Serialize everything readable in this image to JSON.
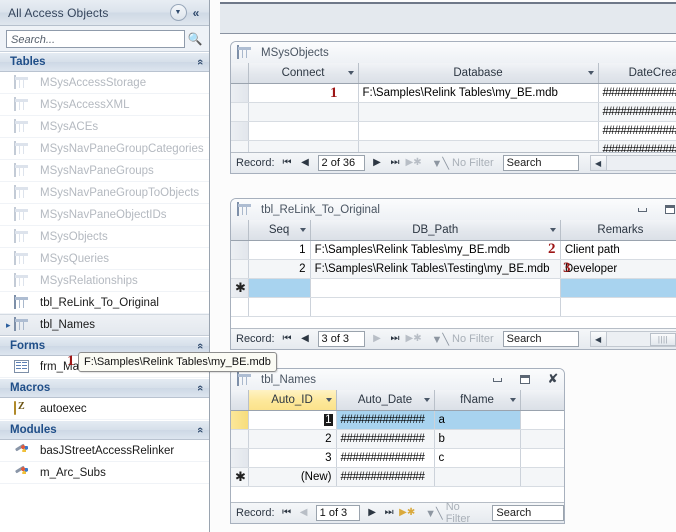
{
  "nav_pane": {
    "title": "All Access Objects",
    "dropdown_icon": "chevron-down-icon",
    "collapse_icon": "double-chevron-left-icon",
    "search": {
      "placeholder": "Search...",
      "value": "",
      "icon": "search-icon"
    },
    "groups": [
      {
        "label": "Tables",
        "collapse_glyph": "«",
        "items": [
          {
            "label": "MSysAccessStorage",
            "icon": "table-icon",
            "dim": true,
            "selected": false,
            "arrow": false
          },
          {
            "label": "MSysAccessXML",
            "icon": "table-icon",
            "dim": true,
            "selected": false,
            "arrow": false
          },
          {
            "label": "MSysACEs",
            "icon": "table-icon",
            "dim": true,
            "selected": false,
            "arrow": false
          },
          {
            "label": "MSysNavPaneGroupCategories",
            "icon": "table-icon",
            "dim": true,
            "selected": false,
            "arrow": false
          },
          {
            "label": "MSysNavPaneGroups",
            "icon": "table-icon",
            "dim": true,
            "selected": false,
            "arrow": false
          },
          {
            "label": "MSysNavPaneGroupToObjects",
            "icon": "table-icon",
            "dim": true,
            "selected": false,
            "arrow": false
          },
          {
            "label": "MSysNavPaneObjectIDs",
            "icon": "table-icon",
            "dim": true,
            "selected": false,
            "arrow": false
          },
          {
            "label": "MSysObjects",
            "icon": "table-icon",
            "dim": true,
            "selected": false,
            "arrow": false
          },
          {
            "label": "MSysQueries",
            "icon": "table-icon",
            "dim": true,
            "selected": false,
            "arrow": false
          },
          {
            "label": "MSysRelationships",
            "icon": "table-icon",
            "dim": true,
            "selected": false,
            "arrow": false
          },
          {
            "label": "tbl_ReLink_To_Original",
            "icon": "table-icon",
            "dim": false,
            "selected": false,
            "arrow": false
          },
          {
            "label": "tbl_Names",
            "icon": "table-icon",
            "dim": false,
            "selected": true,
            "arrow": true
          }
        ]
      },
      {
        "label": "Forms",
        "collapse_glyph": "«",
        "items": [
          {
            "label": "frm_Main",
            "icon": "form-icon",
            "dim": false,
            "selected": false,
            "arrow": false
          }
        ]
      },
      {
        "label": "Macros",
        "collapse_glyph": "«",
        "items": [
          {
            "label": "autoexec",
            "icon": "macro-icon",
            "dim": false,
            "selected": false,
            "arrow": false
          }
        ]
      },
      {
        "label": "Modules",
        "collapse_glyph": "«",
        "items": [
          {
            "label": "basJStreetAccessRelinker",
            "icon": "module-icon",
            "dim": false,
            "selected": false,
            "arrow": false
          },
          {
            "label": "m_Arc_Subs",
            "icon": "module-icon",
            "dim": false,
            "selected": false,
            "arrow": false
          }
        ]
      }
    ],
    "tooltip": "F:\\Samples\\Relink Tables\\my_BE.mdb"
  },
  "windows": {
    "msysobjects": {
      "title": "MSysObjects",
      "icon": "table-icon",
      "columns": [
        "Connect",
        "Database",
        "DateCreate"
      ],
      "rows": [
        {
          "connect": "",
          "database": "F:\\Samples\\Relink Tables\\my_BE.mdb",
          "datecreate": "##############"
        },
        {
          "connect": "",
          "database": "",
          "datecreate": "##############"
        },
        {
          "connect": "",
          "database": "",
          "datecreate": "##############"
        },
        {
          "connect": "",
          "database": "",
          "datecreate": "##############"
        }
      ],
      "navbar": {
        "label": "Record:",
        "first": "⏮",
        "prev": "◀",
        "position": "2 of 36",
        "next": "▶",
        "last": "⏭",
        "new": "▶✱",
        "filter_label": "No Filter",
        "filter_icon": "filter-icon",
        "search_placeholder": "Search",
        "search_value": "Search"
      }
    },
    "relink": {
      "title": "tbl_ReLink_To_Original",
      "icon": "table-icon",
      "controls": [
        "minimize-icon",
        "restore-icon"
      ],
      "columns": [
        "Seq",
        "DB_Path",
        "Remarks"
      ],
      "rows": [
        {
          "seq": "1",
          "db_path": "F:\\Samples\\Relink Tables\\my_BE.mdb",
          "remarks": "Client path"
        },
        {
          "seq": "2",
          "db_path": "F:\\Samples\\Relink Tables\\Testing\\my_BE.mdb",
          "remarks": "Developer"
        },
        {
          "seq": "",
          "db_path": "",
          "remarks": "",
          "is_new": true
        }
      ],
      "new_row_glyph": "✱",
      "navbar": {
        "label": "Record:",
        "first": "⏮",
        "prev": "◀",
        "position": "3 of 3",
        "next": "▶",
        "last": "⏭",
        "new": "▶✱",
        "filter_label": "No Filter",
        "filter_icon": "filter-icon",
        "search_value": "Search"
      }
    },
    "names": {
      "title": "tbl_Names",
      "icon": "table-icon",
      "controls": [
        "minimize-icon",
        "restore-icon",
        "close-icon"
      ],
      "columns": [
        "Auto_ID",
        "Auto_Date",
        "fName"
      ],
      "rows": [
        {
          "auto_id": "1",
          "auto_date": "##############",
          "fname": "a",
          "current": true
        },
        {
          "auto_id": "2",
          "auto_date": "##############",
          "fname": "b",
          "current": false
        },
        {
          "auto_id": "3",
          "auto_date": "##############",
          "fname": "c",
          "current": false
        },
        {
          "auto_id": "(New)",
          "auto_date": "##############",
          "fname": "",
          "is_new": true
        }
      ],
      "new_row_glyph": "✱",
      "navbar": {
        "label": "Record:",
        "first": "⏮",
        "prev": "◀",
        "position": "1 of 3",
        "next": "▶",
        "last": "⏭",
        "new": "▶✱",
        "filter_label": "No Filter",
        "filter_icon": "filter-icon",
        "search_value": "Search"
      }
    }
  },
  "annotations": [
    {
      "label": "1",
      "target": "msysobjects-connect-cell"
    },
    {
      "label": "2",
      "target": "relink-row1-db-path"
    },
    {
      "label": "3",
      "target": "relink-row2-db-path"
    },
    {
      "label": "1",
      "target": "nav-tooltip"
    }
  ],
  "colors": {
    "annotation_red": "#9d1515",
    "selection_blue": "#a8d3ef",
    "current_row_yellow": "#f7dd7c",
    "group_header_text": "#1f4e88"
  }
}
